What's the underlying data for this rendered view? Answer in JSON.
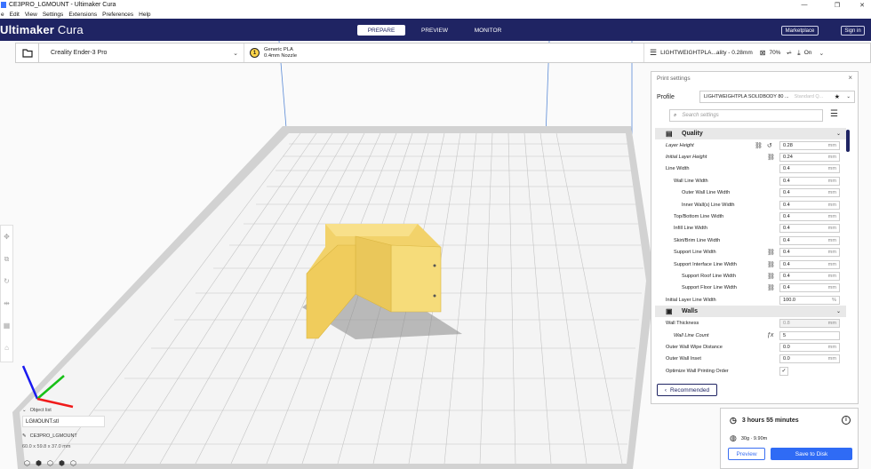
{
  "window": {
    "title": "CE3PRO_LGMOUNT - Ultimaker Cura",
    "minimize": "—",
    "restore": "❐",
    "close": "✕"
  },
  "menu": [
    "e",
    "Edit",
    "View",
    "Settings",
    "Extensions",
    "Preferences",
    "Help"
  ],
  "header": {
    "logo_bold": "Ultimaker",
    "logo_light": " Cura",
    "stages": [
      "PREPARE",
      "PREVIEW",
      "MONITOR"
    ],
    "active_stage": "PREPARE",
    "marketplace": "Marketplace",
    "signin": "Sign in",
    "bg_color": "#1f2463"
  },
  "toolbar": {
    "printer": "Creality Ender-3 Pro",
    "material_badge": "1",
    "material": "Generic PLA",
    "nozzle": "0.4mm Nozzle",
    "profile_summary": "LIGHTWEIGHTPLA...ality - 0.28mm",
    "infill": "70%",
    "support": "On"
  },
  "panel": {
    "title": "Print settings",
    "profile_label": "Profile",
    "profile_value": "LIGHTWEIGHTPLA SOLIDBODY 80 ...",
    "profile_std": "Standard Q...",
    "search_placeholder": "Search settings",
    "recommended": "Recommended",
    "categories": [
      {
        "name": "Quality",
        "icon": "quality-icon",
        "rows": [
          {
            "label": "Layer Height",
            "indent": 0,
            "italic": true,
            "link": true,
            "reset": true,
            "value": "0.28",
            "unit": "mm"
          },
          {
            "label": "Initial Layer Height",
            "indent": 0,
            "italic": true,
            "link": true,
            "value": "0.24",
            "unit": "mm"
          },
          {
            "label": "Line Width",
            "indent": 0,
            "value": "0.4",
            "unit": "mm"
          },
          {
            "label": "Wall Line Width",
            "indent": 1,
            "value": "0.4",
            "unit": "mm"
          },
          {
            "label": "Outer Wall Line Width",
            "indent": 2,
            "value": "0.4",
            "unit": "mm"
          },
          {
            "label": "Inner Wall(s) Line Width",
            "indent": 2,
            "value": "0.4",
            "unit": "mm"
          },
          {
            "label": "Top/Bottom Line Width",
            "indent": 1,
            "value": "0.4",
            "unit": "mm"
          },
          {
            "label": "Infill Line Width",
            "indent": 1,
            "value": "0.4",
            "unit": "mm"
          },
          {
            "label": "Skirt/Brim Line Width",
            "indent": 1,
            "value": "0.4",
            "unit": "mm"
          },
          {
            "label": "Support Line Width",
            "indent": 1,
            "link": true,
            "value": "0.4",
            "unit": "mm"
          },
          {
            "label": "Support Interface Line Width",
            "indent": 1,
            "link": true,
            "value": "0.4",
            "unit": "mm"
          },
          {
            "label": "Support Roof Line Width",
            "indent": 2,
            "link": true,
            "value": "0.4",
            "unit": "mm"
          },
          {
            "label": "Support Floor Line Width",
            "indent": 2,
            "link": true,
            "value": "0.4",
            "unit": "mm"
          },
          {
            "label": "Initial Layer Line Width",
            "indent": 0,
            "value": "100.0",
            "unit": "%"
          }
        ]
      },
      {
        "name": "Walls",
        "icon": "walls-icon",
        "rows": [
          {
            "label": "Wall Thickness",
            "indent": 0,
            "value": "0.8",
            "unit": "mm",
            "disabled": true
          },
          {
            "label": "Wall Line Count",
            "indent": 1,
            "italic": true,
            "fx": true,
            "value": "5",
            "unit": ""
          },
          {
            "label": "Outer Wall Wipe Distance",
            "indent": 0,
            "value": "0.0",
            "unit": "mm"
          },
          {
            "label": "Outer Wall Inset",
            "indent": 0,
            "value": "0.0",
            "unit": "mm"
          },
          {
            "label": "Optimize Wall Printing Order",
            "indent": 0,
            "checkbox": true,
            "checked": true
          }
        ]
      }
    ]
  },
  "objects": {
    "header": "Object list",
    "filename": "LGMOUNT.stl",
    "object_name": "CE3PRO_LGMOUNT",
    "dimensions": "60.0 x 59.8 x 37.0 mm"
  },
  "estimate": {
    "time": "3 hours 55 minutes",
    "material": "30g · 9.90m",
    "preview": "Preview",
    "save": "Save to Disk"
  }
}
